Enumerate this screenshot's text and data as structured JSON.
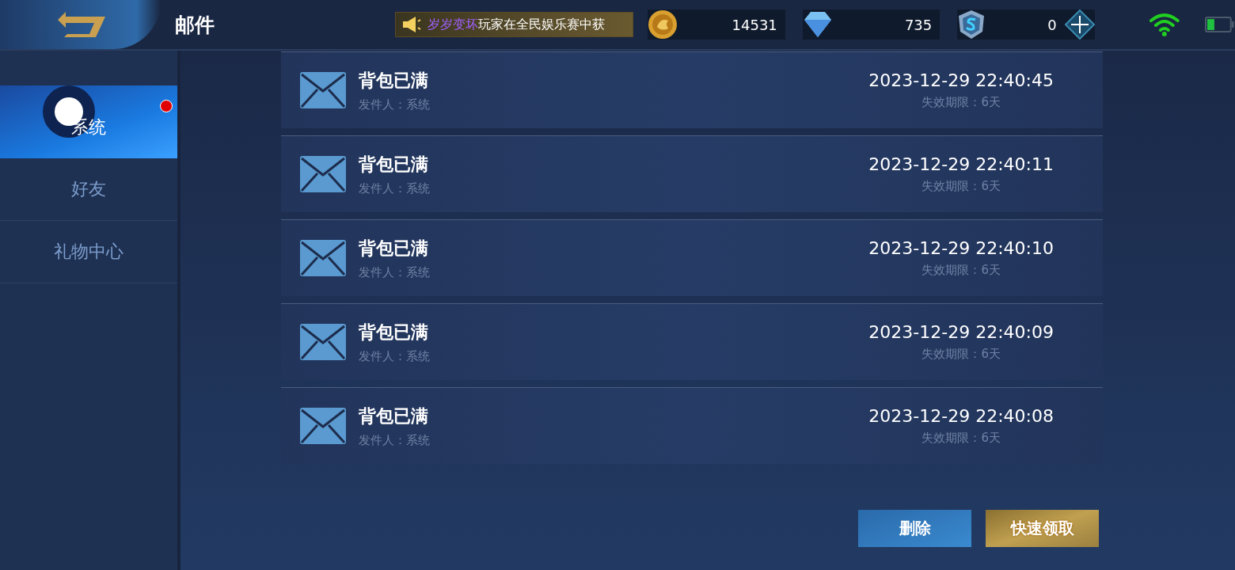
{
  "header": {
    "title": "邮件"
  },
  "ticker": {
    "player": "岁岁变坏",
    "text": "玩家在全民娱乐赛中获"
  },
  "currencies": [
    {
      "kind": "coin",
      "amount": "14531"
    },
    {
      "kind": "diamond",
      "amount": "735"
    },
    {
      "kind": "token",
      "amount": "0"
    }
  ],
  "tabs": [
    {
      "label": "系统",
      "selected": true,
      "unread": true
    },
    {
      "label": "好友",
      "selected": false,
      "unread": false
    },
    {
      "label": "礼物中心",
      "selected": false,
      "unread": false
    }
  ],
  "mails": [
    {
      "title": "背包已满",
      "sender": "发件人：系统",
      "time": "2023-12-29 22:40:45",
      "expiry": "失效期限：6天"
    },
    {
      "title": "背包已满",
      "sender": "发件人：系统",
      "time": "2023-12-29 22:40:11",
      "expiry": "失效期限：6天"
    },
    {
      "title": "背包已满",
      "sender": "发件人：系统",
      "time": "2023-12-29 22:40:10",
      "expiry": "失效期限：6天"
    },
    {
      "title": "背包已满",
      "sender": "发件人：系统",
      "time": "2023-12-29 22:40:09",
      "expiry": "失效期限：6天"
    },
    {
      "title": "背包已满",
      "sender": "发件人：系统",
      "time": "2023-12-29 22:40:08",
      "expiry": "失效期限：6天"
    }
  ],
  "buttons": [
    {
      "kind": "secondary",
      "label": "删除"
    },
    {
      "kind": "primary",
      "label": "快速领取"
    }
  ]
}
